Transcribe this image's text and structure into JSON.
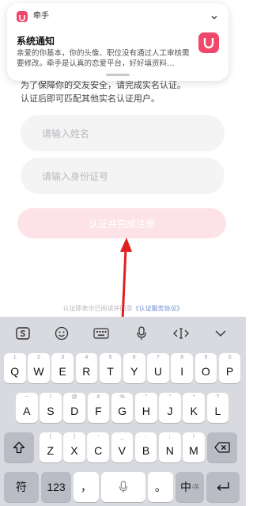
{
  "page": {
    "desc_line1": "为了保障你的交友安全，请完成实名认证。",
    "desc_line2": "认证后即可匹配其他实名认证用户。",
    "name_placeholder": "请输入姓名",
    "id_placeholder": "请输入身份证号",
    "submit_label": "认证并完成注册",
    "agree_prefix": "认证即表示已阅读并同意",
    "agree_link": "《认证服务协议》"
  },
  "notification": {
    "app_name": "牵手",
    "title": "系统通知",
    "body": "亲爱的你基本，你的头像、职位没有通过人工审核需要修改。牵手是认真的恋爱平台，好好填资料…",
    "app_icon": "qianshou-app-icon",
    "accent": "#f0476b"
  },
  "keyboard": {
    "toolbar": [
      "sogou-logo-icon",
      "emoji-icon",
      "keyboard-icon",
      "microphone-icon",
      "cursor-move-icon",
      "collapse-chevron-icon"
    ],
    "row1": [
      {
        "key": "Q",
        "sub": "1"
      },
      {
        "key": "W",
        "sub": "2"
      },
      {
        "key": "E",
        "sub": "3"
      },
      {
        "key": "R",
        "sub": "4"
      },
      {
        "key": "T",
        "sub": "5"
      },
      {
        "key": "Y",
        "sub": "6"
      },
      {
        "key": "U",
        "sub": "7"
      },
      {
        "key": "I",
        "sub": "8"
      },
      {
        "key": "O",
        "sub": "9"
      },
      {
        "key": "P",
        "sub": "0"
      }
    ],
    "row2": [
      {
        "key": "A",
        "sub": "~"
      },
      {
        "key": "S",
        "sub": "!"
      },
      {
        "key": "D",
        "sub": "@"
      },
      {
        "key": "F",
        "sub": "#"
      },
      {
        "key": "G",
        "sub": "%"
      },
      {
        "key": "H",
        "sub": "\""
      },
      {
        "key": "J",
        "sub": "“"
      },
      {
        "key": "K",
        "sub": "*"
      },
      {
        "key": "L",
        "sub": "?"
      }
    ],
    "row3": [
      {
        "key": "Z",
        "sub": "("
      },
      {
        "key": "X",
        "sub": ")"
      },
      {
        "key": "C",
        "sub": "-"
      },
      {
        "key": "V",
        "sub": "_"
      },
      {
        "key": "B",
        "sub": ":"
      },
      {
        "key": "N",
        "sub": ";"
      },
      {
        "key": "M",
        "sub": "/"
      }
    ],
    "bottom": {
      "symbols": "符",
      "numbers": "123",
      "comma": "，",
      "period": "。",
      "lang": "中",
      "lang_sub": "/英"
    }
  }
}
